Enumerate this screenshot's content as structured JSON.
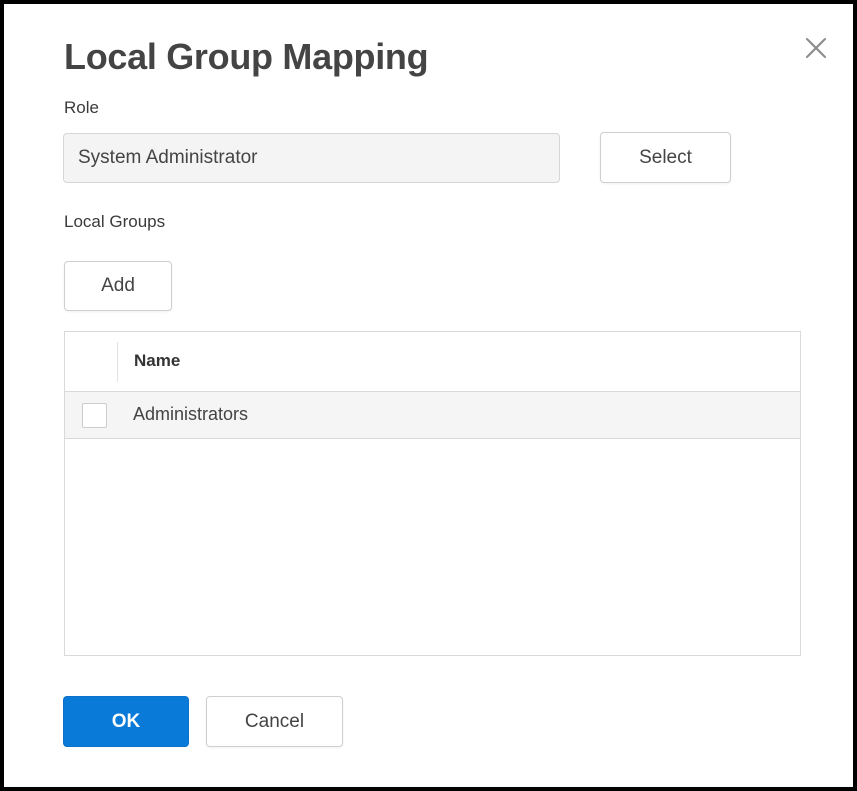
{
  "dialog": {
    "title": "Local Group Mapping",
    "close_icon": "close-icon"
  },
  "role": {
    "label": "Role",
    "value": "System Administrator",
    "select_label": "Select"
  },
  "local_groups": {
    "label": "Local Groups",
    "add_label": "Add",
    "table": {
      "columns": [
        "Name"
      ],
      "rows": [
        {
          "name": "Administrators",
          "checked": false
        }
      ]
    }
  },
  "footer": {
    "ok_label": "OK",
    "cancel_label": "Cancel"
  },
  "colors": {
    "primary": "#0a7ad8",
    "frame_border": "#000000",
    "input_bg": "#f4f4f4",
    "row_bg": "#f5f5f5"
  }
}
